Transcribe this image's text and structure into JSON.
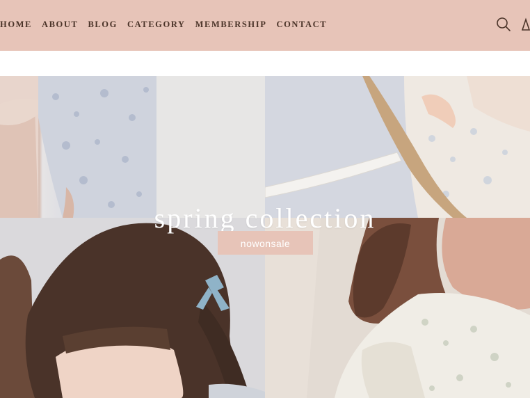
{
  "nav": {
    "items": [
      {
        "label": "HOME"
      },
      {
        "label": "ABOUT"
      },
      {
        "label": "BLOG"
      },
      {
        "label": "CATEGORY"
      },
      {
        "label": "MEMBERSHIP"
      },
      {
        "label": "CONTACT"
      }
    ],
    "icons": [
      "search-icon",
      "account-icon"
    ]
  },
  "hero": {
    "title": "spring collection",
    "cta_label": "nowonsale"
  },
  "colors": {
    "header_bg": "#e7c4b8",
    "nav_text": "#4a3328",
    "cta_bg": "#e7c4b8",
    "hero_text": "#ffffff"
  }
}
